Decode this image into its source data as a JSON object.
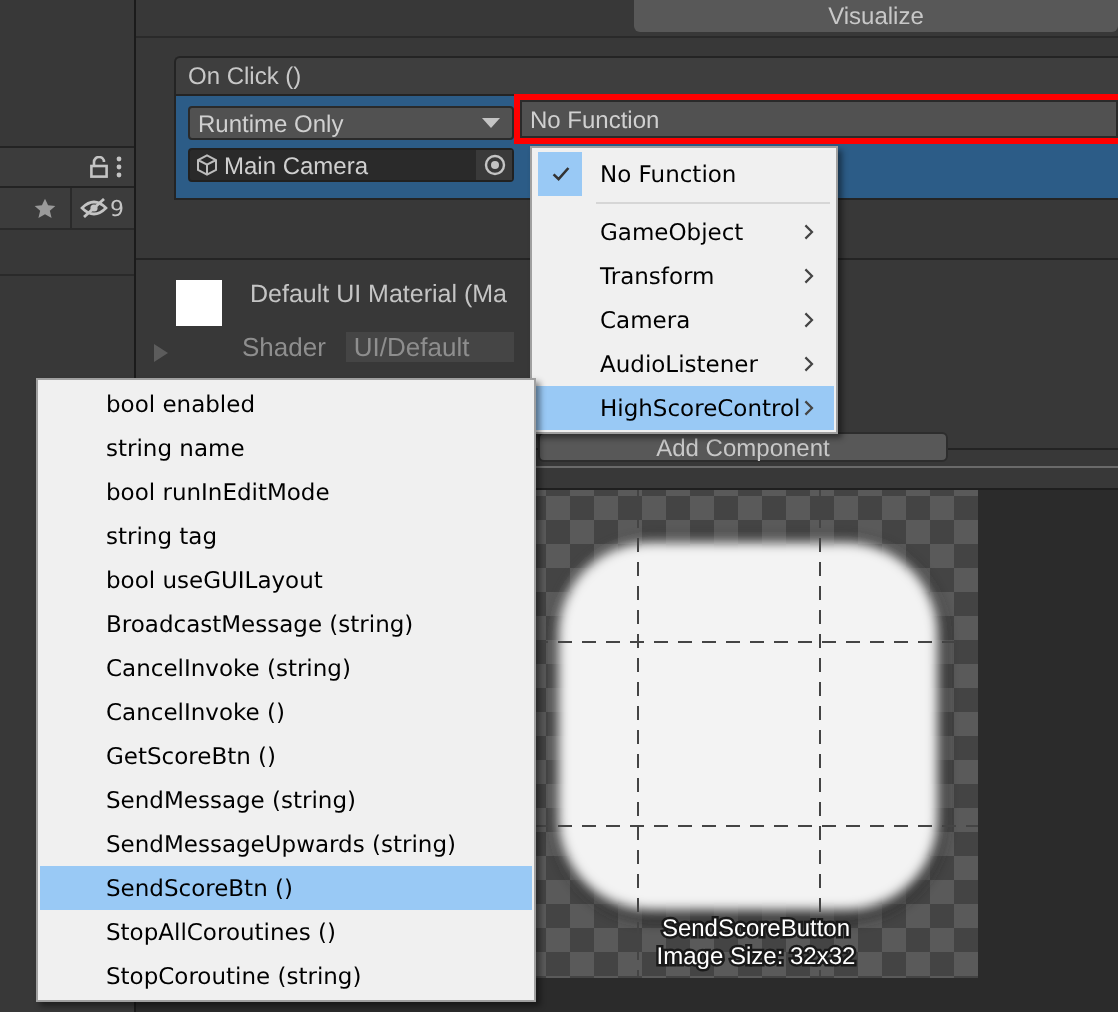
{
  "hierarchy": {
    "hidden_count": "9"
  },
  "inspector": {
    "visualize_button": "Visualize",
    "on_click": {
      "title": "On Click ()",
      "runtime": "Runtime Only",
      "target": "Main Camera",
      "function": "No Function",
      "function_highlighted": true
    },
    "material": {
      "name": "Default UI Material (Ma",
      "shader_label": "Shader",
      "shader": "UI/Default"
    },
    "add_component": "Add Component"
  },
  "function_menu": {
    "items": [
      {
        "kind": "check",
        "label": "No Function",
        "checked": true,
        "selected": false
      },
      {
        "kind": "submenu",
        "label": "GameObject",
        "selected": false
      },
      {
        "kind": "submenu",
        "label": "Transform",
        "selected": false
      },
      {
        "kind": "submenu",
        "label": "Camera",
        "selected": false
      },
      {
        "kind": "submenu",
        "label": "AudioListener",
        "selected": false
      },
      {
        "kind": "submenu",
        "label": "HighScoreControl",
        "selected": true
      }
    ]
  },
  "submenu": {
    "items": [
      {
        "label": "bool enabled",
        "selected": false
      },
      {
        "label": "string name",
        "selected": false
      },
      {
        "label": "bool runInEditMode",
        "selected": false
      },
      {
        "label": "string tag",
        "selected": false
      },
      {
        "label": "bool useGUILayout",
        "selected": false
      },
      {
        "label": "BroadcastMessage (string)",
        "selected": false
      },
      {
        "label": "CancelInvoke (string)",
        "selected": false
      },
      {
        "label": "CancelInvoke ()",
        "selected": false
      },
      {
        "label": "GetScoreBtn ()",
        "selected": false
      },
      {
        "label": "SendMessage (string)",
        "selected": false
      },
      {
        "label": "SendMessageUpwards (string)",
        "selected": false
      },
      {
        "label": "SendScoreBtn ()",
        "selected": true
      },
      {
        "label": "StopAllCoroutines ()",
        "selected": false
      },
      {
        "label": "StopCoroutine (string)",
        "selected": false
      }
    ]
  },
  "preview": {
    "sprite_name": "SendScoreButton",
    "image_size": "Image Size: 32x32"
  }
}
